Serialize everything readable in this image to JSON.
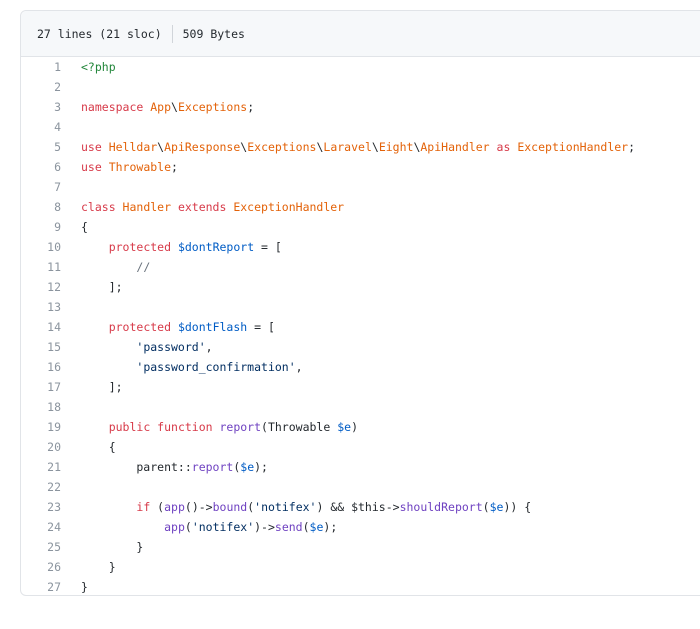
{
  "header": {
    "lines_info": "27 lines (21 sloc)",
    "size_info": "509 Bytes"
  },
  "code_lines": [
    {
      "n": "1",
      "tokens": [
        {
          "t": "<?php",
          "c": "php"
        }
      ]
    },
    {
      "n": "2",
      "tokens": []
    },
    {
      "n": "3",
      "tokens": [
        {
          "t": "namespace ",
          "c": "kw"
        },
        {
          "t": "App",
          "c": "name"
        },
        {
          "t": "\\",
          "c": ""
        },
        {
          "t": "Exceptions",
          "c": "name"
        },
        {
          "t": ";",
          "c": ""
        }
      ]
    },
    {
      "n": "4",
      "tokens": []
    },
    {
      "n": "5",
      "tokens": [
        {
          "t": "use ",
          "c": "kw"
        },
        {
          "t": "Helldar",
          "c": "name"
        },
        {
          "t": "\\",
          "c": ""
        },
        {
          "t": "ApiResponse",
          "c": "name"
        },
        {
          "t": "\\",
          "c": ""
        },
        {
          "t": "Exceptions",
          "c": "name"
        },
        {
          "t": "\\",
          "c": ""
        },
        {
          "t": "Laravel",
          "c": "name"
        },
        {
          "t": "\\",
          "c": ""
        },
        {
          "t": "Eight",
          "c": "name"
        },
        {
          "t": "\\",
          "c": ""
        },
        {
          "t": "ApiHandler",
          "c": "name"
        },
        {
          "t": " as ",
          "c": "kw"
        },
        {
          "t": "ExceptionHandler",
          "c": "name"
        },
        {
          "t": ";",
          "c": ""
        }
      ]
    },
    {
      "n": "6",
      "tokens": [
        {
          "t": "use ",
          "c": "kw"
        },
        {
          "t": "Throwable",
          "c": "name"
        },
        {
          "t": ";",
          "c": ""
        }
      ]
    },
    {
      "n": "7",
      "tokens": []
    },
    {
      "n": "8",
      "tokens": [
        {
          "t": "class ",
          "c": "kw"
        },
        {
          "t": "Handler",
          "c": "name"
        },
        {
          "t": " extends ",
          "c": "kw"
        },
        {
          "t": "ExceptionHandler",
          "c": "name"
        }
      ]
    },
    {
      "n": "9",
      "tokens": [
        {
          "t": "{",
          "c": ""
        }
      ]
    },
    {
      "n": "10",
      "tokens": [
        {
          "t": "    ",
          "c": ""
        },
        {
          "t": "protected ",
          "c": "kw"
        },
        {
          "t": "$dontReport",
          "c": "var"
        },
        {
          "t": " = [",
          "c": ""
        }
      ]
    },
    {
      "n": "11",
      "tokens": [
        {
          "t": "        ",
          "c": ""
        },
        {
          "t": "//",
          "c": "cmt"
        }
      ]
    },
    {
      "n": "12",
      "tokens": [
        {
          "t": "    ];",
          "c": ""
        }
      ]
    },
    {
      "n": "13",
      "tokens": []
    },
    {
      "n": "14",
      "tokens": [
        {
          "t": "    ",
          "c": ""
        },
        {
          "t": "protected ",
          "c": "kw"
        },
        {
          "t": "$dontFlash",
          "c": "var"
        },
        {
          "t": " = [",
          "c": ""
        }
      ]
    },
    {
      "n": "15",
      "tokens": [
        {
          "t": "        ",
          "c": ""
        },
        {
          "t": "'password'",
          "c": "str"
        },
        {
          "t": ",",
          "c": ""
        }
      ]
    },
    {
      "n": "16",
      "tokens": [
        {
          "t": "        ",
          "c": ""
        },
        {
          "t": "'password_confirmation'",
          "c": "str"
        },
        {
          "t": ",",
          "c": ""
        }
      ]
    },
    {
      "n": "17",
      "tokens": [
        {
          "t": "    ];",
          "c": ""
        }
      ]
    },
    {
      "n": "18",
      "tokens": []
    },
    {
      "n": "19",
      "tokens": [
        {
          "t": "    ",
          "c": ""
        },
        {
          "t": "public ",
          "c": "kw"
        },
        {
          "t": "function ",
          "c": "kw"
        },
        {
          "t": "report",
          "c": "fn"
        },
        {
          "t": "(Throwable ",
          "c": ""
        },
        {
          "t": "$e",
          "c": "var"
        },
        {
          "t": ")",
          "c": ""
        }
      ]
    },
    {
      "n": "20",
      "tokens": [
        {
          "t": "    {",
          "c": ""
        }
      ]
    },
    {
      "n": "21",
      "tokens": [
        {
          "t": "        parent::",
          "c": ""
        },
        {
          "t": "report",
          "c": "fn"
        },
        {
          "t": "(",
          "c": ""
        },
        {
          "t": "$e",
          "c": "var"
        },
        {
          "t": ");",
          "c": ""
        }
      ]
    },
    {
      "n": "22",
      "tokens": []
    },
    {
      "n": "23",
      "tokens": [
        {
          "t": "        ",
          "c": ""
        },
        {
          "t": "if ",
          "c": "kw"
        },
        {
          "t": "(",
          "c": ""
        },
        {
          "t": "app",
          "c": "fn"
        },
        {
          "t": "()->",
          "c": ""
        },
        {
          "t": "bound",
          "c": "fn"
        },
        {
          "t": "(",
          "c": ""
        },
        {
          "t": "'notifex'",
          "c": "str"
        },
        {
          "t": ") && $this->",
          "c": ""
        },
        {
          "t": "shouldReport",
          "c": "fn"
        },
        {
          "t": "(",
          "c": ""
        },
        {
          "t": "$e",
          "c": "var"
        },
        {
          "t": ")) {",
          "c": ""
        }
      ]
    },
    {
      "n": "24",
      "tokens": [
        {
          "t": "            ",
          "c": ""
        },
        {
          "t": "app",
          "c": "fn"
        },
        {
          "t": "(",
          "c": ""
        },
        {
          "t": "'notifex'",
          "c": "str"
        },
        {
          "t": ")->",
          "c": ""
        },
        {
          "t": "send",
          "c": "fn"
        },
        {
          "t": "(",
          "c": ""
        },
        {
          "t": "$e",
          "c": "var"
        },
        {
          "t": ");",
          "c": ""
        }
      ]
    },
    {
      "n": "25",
      "tokens": [
        {
          "t": "        }",
          "c": ""
        }
      ]
    },
    {
      "n": "26",
      "tokens": [
        {
          "t": "    }",
          "c": ""
        }
      ]
    },
    {
      "n": "27",
      "tokens": [
        {
          "t": "}",
          "c": ""
        }
      ]
    }
  ]
}
